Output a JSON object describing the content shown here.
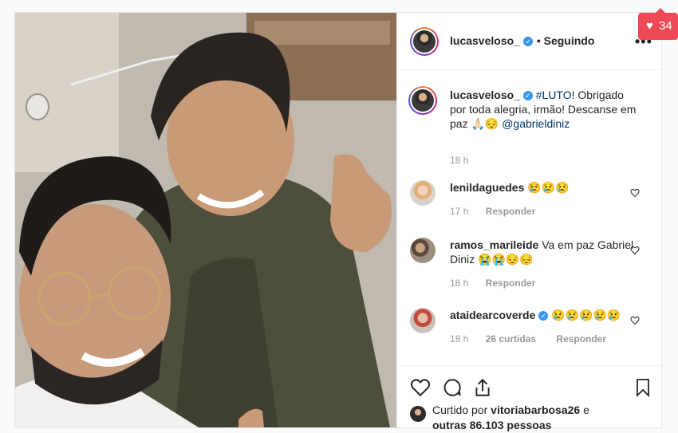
{
  "post": {
    "author": "lucasveloso_",
    "follow_status": "• Seguindo",
    "caption": {
      "username": "lucasveloso_",
      "hashtag": "#LUTO",
      "text": "! Obrigado por toda alegria, irmão! Descanse em paz 🙏🏻😔 ",
      "mention": "@gabrieldiniz",
      "time": "18 h"
    },
    "comments": [
      {
        "username": "lenildaguedes",
        "text": "😢😢😢",
        "time": "17 h",
        "replies": "",
        "reply_label": "Responder"
      },
      {
        "username": "ramos_marileide",
        "text": "Va em paz Gabriel Diniz 😭😭😔😔",
        "time": "18 h",
        "replies": "",
        "reply_label": "Responder"
      },
      {
        "username": "ataidearcoverde",
        "text": "😢😢😢😢😢",
        "time": "18 h",
        "replies": "26 curtidas",
        "reply_label": "Responder"
      }
    ],
    "liked_by": {
      "prefix": "Curtido por ",
      "user": "vitoriabarbosa26",
      "middle": " e",
      "others": "outras 86.103 pessoas"
    }
  },
  "notification": {
    "count": "34"
  },
  "colors": {
    "accent": "#3897f0",
    "notification": "#ed4956",
    "meta": "#999999"
  }
}
